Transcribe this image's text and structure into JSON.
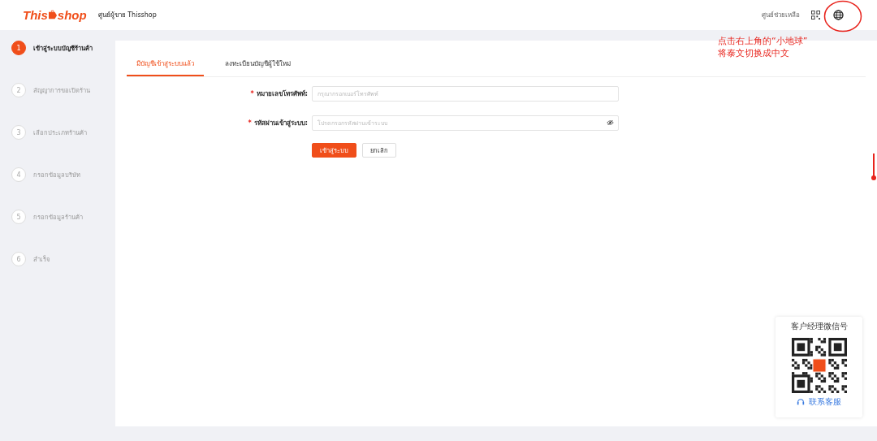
{
  "header": {
    "logo": {
      "part1": "This",
      "part2": "shop"
    },
    "title": "ศูนย์ผู้ขาย Thisshop",
    "help_link": "ศูนย์ช่วยเหลือ"
  },
  "annotation": {
    "lines": [
      "点击右上角的“小地球”",
      "将泰文切换成中文"
    ]
  },
  "steps": [
    {
      "number": "1",
      "label": "เข้าสู่ระบบบัญชีร้านค้า",
      "selected": true
    },
    {
      "number": "2",
      "label": "สัญญาการขอเปิดร้าน",
      "selected": false
    },
    {
      "number": "3",
      "label": "เลือกประเภทร้านค้า",
      "selected": false
    },
    {
      "number": "4",
      "label": "กรอกข้อมูลบริษัท",
      "selected": false
    },
    {
      "number": "5",
      "label": "กรอกข้อมูลร้านค้า",
      "selected": false
    },
    {
      "number": "6",
      "label": "สำเร็จ",
      "selected": false
    }
  ],
  "tabs": [
    {
      "label": "มีบัญชีเข้าสู่ระบบแล้ว",
      "selected": true
    },
    {
      "label": "ลงทะเบียนบัญชีผู้ใช้ใหม่",
      "selected": false
    }
  ],
  "form": {
    "fields": [
      {
        "required_mark": "*",
        "label": "หมายเลขโทรศัพท์:",
        "placeholder": "กรุณากรอกเบอร์โทรศัพท์",
        "kind": "text"
      },
      {
        "required_mark": "*",
        "label": "รหัสผ่านเข้าสู่ระบบ:",
        "placeholder": "โปรดกรอกรหัสผ่านเข้าระบบ",
        "kind": "password"
      }
    ],
    "buttons": [
      {
        "label": "เข้าสู่ระบบ",
        "kind": "primary"
      },
      {
        "label": "ยกเลิก",
        "kind": "secondary"
      }
    ]
  },
  "qr_card": {
    "title": "客户经理微信号",
    "contact_link": "联系客服"
  }
}
